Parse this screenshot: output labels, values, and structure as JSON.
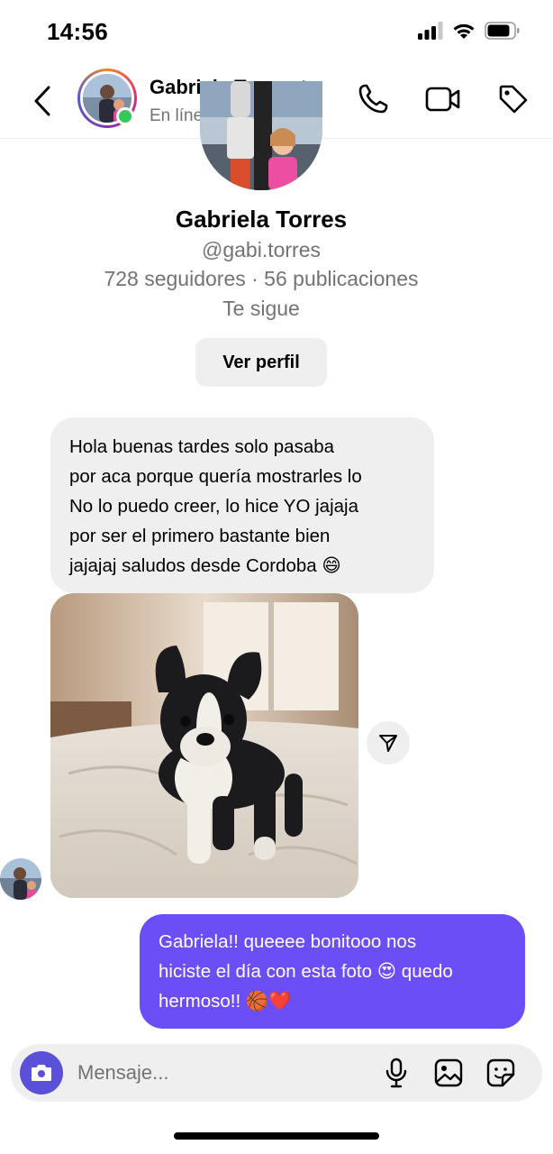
{
  "status_bar": {
    "time": "14:56",
    "icons": [
      "signal-icon",
      "wifi-icon",
      "battery-icon"
    ]
  },
  "header": {
    "back_icon": "chevron-left-icon",
    "name": "Gabriela Torres",
    "name_chevron": "chevron-right-icon",
    "status": "En línea",
    "actions": [
      "phone-icon",
      "video-camera-icon",
      "tag-icon"
    ],
    "online_color": "#34c759"
  },
  "profile": {
    "name": "Gabriela Torres",
    "handle": "@gabi.torres",
    "stats": "728 seguidores · 56 publicaciones",
    "follows": "Te sigue",
    "view_profile_label": "Ver perfil"
  },
  "messages": [
    {
      "sender": "contact",
      "type": "text",
      "lines": [
        "Hola buenas tardes solo pasaba",
        "por aca porque quería mostrarles lo",
        "No lo puedo creer, lo hice YO jajaja",
        "por ser el primero bastante bien",
        "jajajaj saludos desde Cordoba 😄"
      ]
    },
    {
      "sender": "contact",
      "type": "image",
      "share_icon": "paper-plane-icon"
    },
    {
      "sender": "me",
      "type": "text",
      "lines": [
        "Gabriela!! queeee bonitooo nos",
        "hiciste el día con esta foto 😍 quedo",
        "hermoso!! 🏀❤️"
      ]
    }
  ],
  "composer": {
    "camera_icon": "camera-icon",
    "placeholder": "Mensaje...",
    "actions": [
      "microphone-icon",
      "image-icon",
      "sticker-icon"
    ]
  },
  "colors": {
    "outgoing_bubble": "#6b4ef5",
    "incoming_bubble": "#efefef",
    "camera_button": "#5b51d8",
    "secondary_text": "#737373"
  }
}
